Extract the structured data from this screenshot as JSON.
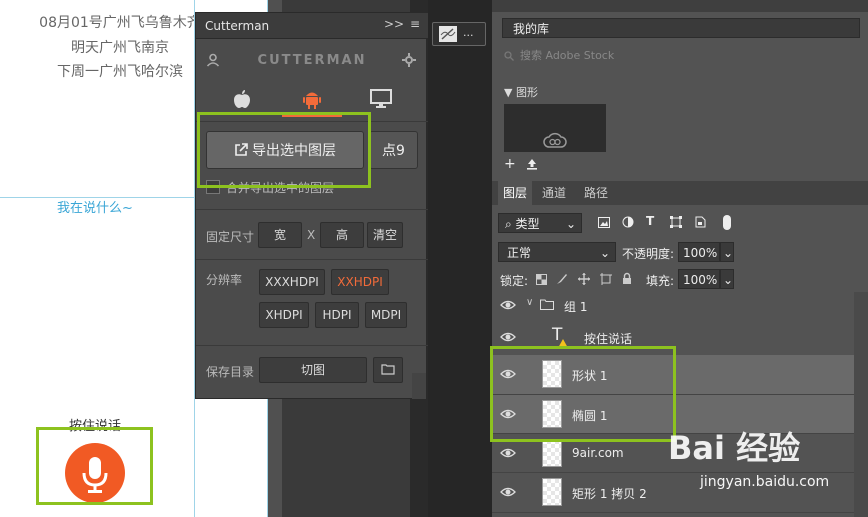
{
  "canvas": {
    "lines": [
      "08月01号广州飞乌鲁木齐",
      "明天广州飞南京",
      "下周一广州飞哈尔滨"
    ],
    "say_text": "我在说什么~",
    "hold_label": "按住说话"
  },
  "cutterman": {
    "title": "Cutterman",
    "expand_icon": ">>",
    "menu_icon": "≡",
    "brand": "CUTTERMAN",
    "platform_icons": [
      "apple-icon",
      "android-icon",
      "desktop-icon"
    ],
    "export_label": "导出选中图层",
    "dot9_label": "点9",
    "merge_label": "合并导出选中的图层",
    "fixed_size_label": "固定尺寸",
    "width_label": "宽",
    "x_label": "X",
    "height_label": "高",
    "clear_label": "清空",
    "resolution_label": "分辨率",
    "resolutions": [
      "XXXHDPI",
      "XXHDPI",
      "XHDPI",
      "HDPI",
      "MDPI"
    ],
    "active_resolution": "XXHDPI",
    "save_dir_label": "保存目录",
    "cut_label": "切图"
  },
  "mid_panel": {
    "tab_label": "..."
  },
  "photoshop": {
    "library": "我的库",
    "stock_placeholder": "搜索 Adobe Stock",
    "graphics_title": "图形",
    "tabs": [
      "图层",
      "通道",
      "路径"
    ],
    "kind_filter": "类型",
    "blend_mode": "正常",
    "opacity_label": "不透明度:",
    "opacity_value": "100%",
    "lock_label": "锁定:",
    "fill_label": "填充:",
    "fill_value": "100%",
    "layers": [
      {
        "name": "组 1",
        "type": "group"
      },
      {
        "name": "按住说话",
        "type": "text"
      },
      {
        "name": "形状 1",
        "type": "shape"
      },
      {
        "name": "椭圆 1",
        "type": "shape"
      },
      {
        "name": "9air.com",
        "type": "raster"
      },
      {
        "name": "矩形 1 拷贝 2",
        "type": "shape"
      }
    ]
  },
  "watermark": {
    "logo": "Bai 经验",
    "subtitle": "jingyan.baidu.com"
  },
  "colors": {
    "highlight_box": "#8dc21f",
    "mic_button": "#f15a24",
    "guide_line": "#9fd4e8",
    "active_resolution": "#f26b3a"
  }
}
